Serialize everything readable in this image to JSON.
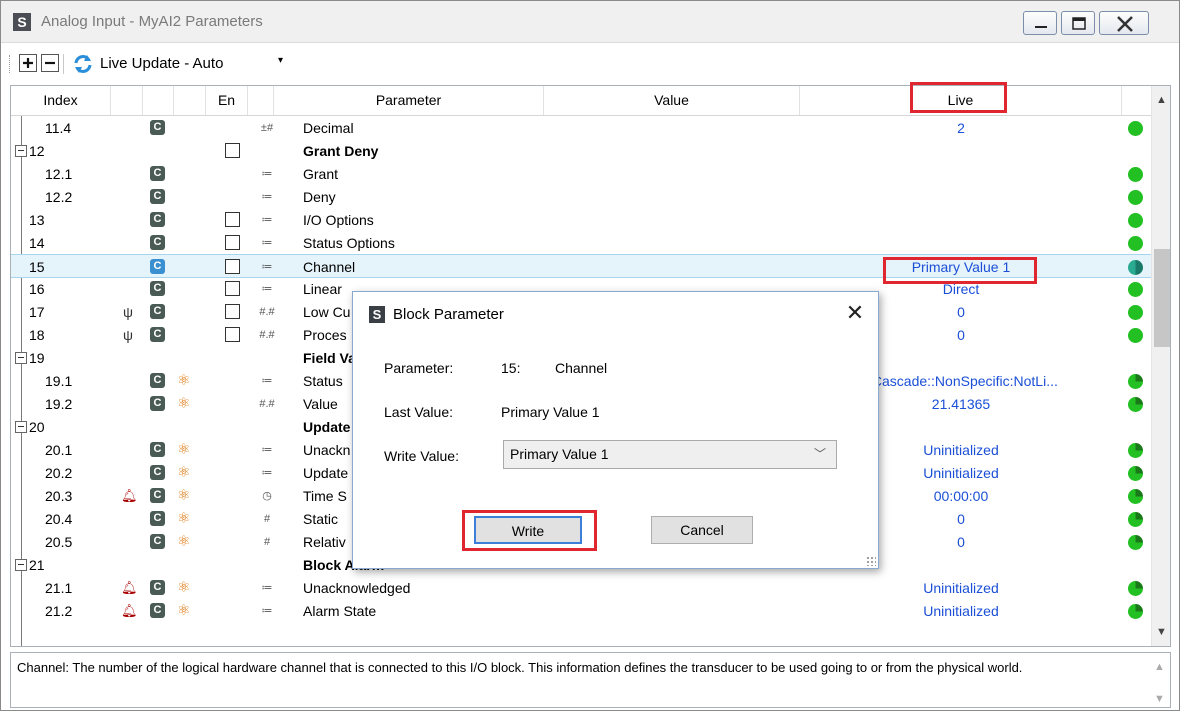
{
  "window": {
    "title": "Analog Input - MyAI2 Parameters",
    "app_icon_letter": "S",
    "controls": [
      "minimize-icon",
      "maximize-icon",
      "close-icon"
    ]
  },
  "toolbar": {
    "expand_label": "expand-all-icon",
    "collapse_label": "collapse-all-icon",
    "live_update_label": "Live Update - Auto",
    "dropdown_glyph": "▾"
  },
  "grid": {
    "columns": [
      "Index",
      "En",
      "Parameter",
      "Value",
      "Live"
    ],
    "rows": [
      {
        "index": "11.4",
        "type": "±#",
        "param": "Decimal",
        "live": "2"
      },
      {
        "index": "12",
        "param": "Grant Deny",
        "live": ""
      },
      {
        "index": "12.1",
        "type": "≔",
        "param": "Grant",
        "live": ""
      },
      {
        "index": "12.2",
        "type": "≔",
        "param": "Deny",
        "live": ""
      },
      {
        "index": "13",
        "type": "≔",
        "param": "I/O Options",
        "live": ""
      },
      {
        "index": "14",
        "type": "≔",
        "param": "Status Options",
        "live": ""
      },
      {
        "index": "15",
        "type": "≔",
        "param": "Channel",
        "live": "Primary Value 1"
      },
      {
        "index": "16",
        "type": "≔",
        "param": "Linear",
        "live": "Direct"
      },
      {
        "index": "17",
        "type": "#.#",
        "param": "Low Cu",
        "live": "0"
      },
      {
        "index": "18",
        "type": "#.#",
        "param": "Proces",
        "live": "0"
      },
      {
        "index": "19",
        "param": "Field Val",
        "live": ""
      },
      {
        "index": "19.1",
        "type": "≔",
        "param": "Status",
        "live": "nCascade::NonSpecific:NotLi..."
      },
      {
        "index": "19.2",
        "type": "#.#",
        "param": "Value",
        "live": "21.41365"
      },
      {
        "index": "20",
        "param": "Update E",
        "live": ""
      },
      {
        "index": "20.1",
        "type": "≔",
        "param": "Unackn",
        "live": "Uninitialized"
      },
      {
        "index": "20.2",
        "type": "≔",
        "param": "Update",
        "live": "Uninitialized"
      },
      {
        "index": "20.3",
        "type": "◷",
        "param": "Time S",
        "live": "00:00:00"
      },
      {
        "index": "20.4",
        "type": "#",
        "param": "Static",
        "live": "0"
      },
      {
        "index": "20.5",
        "type": "#",
        "param": "Relativ",
        "live": "0"
      },
      {
        "index": "21",
        "param": "Block Alarm",
        "live": ""
      },
      {
        "index": "21.1",
        "type": "≔",
        "param": "Unacknowledged",
        "live": "Uninitialized"
      },
      {
        "index": "21.2",
        "type": "≔",
        "param": "Alarm State",
        "live": "Uninitialized"
      }
    ],
    "c_badge": "C"
  },
  "description": "Channel: The number of the logical hardware channel that is connected to this I/O block. This information defines the transducer to be used going to or from the physical world.",
  "dialog": {
    "title": "Block Parameter",
    "icon_letter": "S",
    "close_glyph": "✕",
    "parameter_label": "Parameter:",
    "parameter_number": "15:",
    "parameter_name": "Channel",
    "last_value_label": "Last Value:",
    "last_value": "Primary Value 1",
    "write_value_label": "Write Value:",
    "write_value": "Primary Value 1",
    "write_button": "Write",
    "cancel_button": "Cancel"
  },
  "colors": {
    "live_text": "#1a4fd6",
    "highlight_box": "#e0262e",
    "status_dot": "#22c022",
    "selected_row": "#e5f3fb"
  }
}
